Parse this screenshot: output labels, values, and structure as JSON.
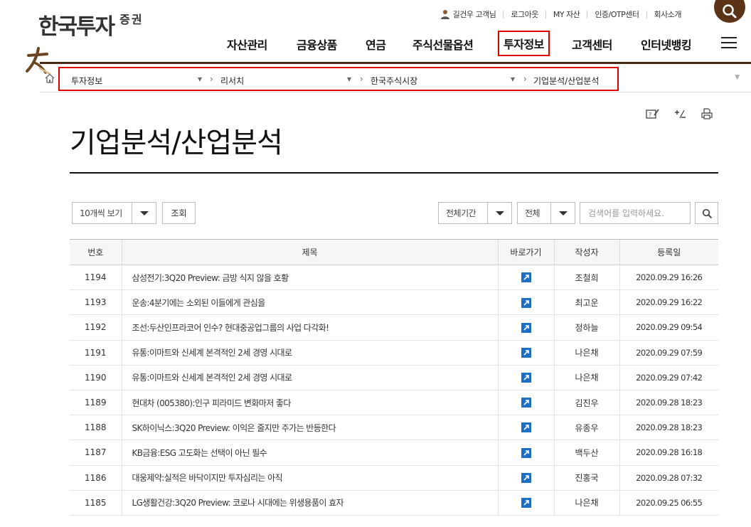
{
  "header": {
    "logo_main": "한국투자",
    "logo_sub": "증권",
    "util": {
      "user": "길건우 고객님",
      "logout": "로그아웃",
      "my_asset": "MY 자산",
      "cert": "인증/OTP센터",
      "company": "회사소개"
    },
    "gnb": [
      "자산관리",
      "금융상품",
      "연금",
      "주식선물옵션",
      "투자정보",
      "고객센터",
      "인터넷뱅킹"
    ],
    "gnb_active": "투자정보"
  },
  "breadcrumb": [
    "투자정보",
    "리서치",
    "한국주식시장",
    "기업분석/산업분석"
  ],
  "page_title": "기업분석/산업분석",
  "filters": {
    "per_page": "10개씩 보기",
    "search_button": "조회",
    "period": "전체기간",
    "category": "전체",
    "search_placeholder": "검색어를 입력하세요."
  },
  "table": {
    "columns": [
      "번호",
      "제목",
      "바로가기",
      "작성자",
      "등록일"
    ],
    "rows": [
      {
        "no": "1194",
        "title": "삼성전기:3Q20 Preview: 금방 식지 않을 호황",
        "author": "조철희",
        "date": "2020.09.29 16:26"
      },
      {
        "no": "1193",
        "title": "운송:4분기에는 소외된 이들에게 관심을",
        "author": "최고운",
        "date": "2020.09.29 16:22"
      },
      {
        "no": "1192",
        "title": "조선:두산인프라코어 인수? 현대중공업그룹의 사업 다각화!",
        "author": "정하늘",
        "date": "2020.09.29 09:54"
      },
      {
        "no": "1191",
        "title": "유통:이마트와 신세계 본격적인 2세 경영 시대로",
        "author": "나은채",
        "date": "2020.09.29 07:59"
      },
      {
        "no": "1190",
        "title": "유통:이마트와 신세계 본격적인 2세 경영 시대로",
        "author": "나은채",
        "date": "2020.09.29 07:42"
      },
      {
        "no": "1189",
        "title": "현대차 (005380):인구 피라미드 변화마저 좋다",
        "author": "김진우",
        "date": "2020.09.28 18:23"
      },
      {
        "no": "1188",
        "title": "SK하이닉스:3Q20 Preview: 이익은 줄지만 주가는 반등한다",
        "author": "유종우",
        "date": "2020.09.28 18:23"
      },
      {
        "no": "1187",
        "title": "KB금융:ESG 고도화는 선택이 아닌 필수",
        "author": "백두산",
        "date": "2020.09.28 16:18"
      },
      {
        "no": "1186",
        "title": "대웅제약:실적은 바닥이지만 투자심리는 아직",
        "author": "진홍국",
        "date": "2020.09.28 07:32"
      },
      {
        "no": "1185",
        "title": "LG생활건강:3Q20 Preview: 코로나 시대에는 위생용품이 효자",
        "author": "나은채",
        "date": "2020.09.25 06:55"
      }
    ]
  },
  "colors": {
    "brand_brown": "#4b2a13",
    "highlight_red": "#e10000",
    "link_blue": "#1f6fc5"
  }
}
